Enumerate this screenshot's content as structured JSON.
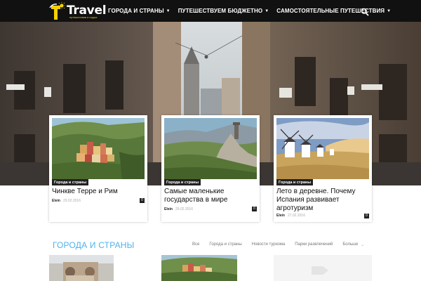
{
  "header": {
    "logo_text": "Travel",
    "logo_subtitle": "путешествия и отдых",
    "nav": [
      {
        "label": "Города и страны"
      },
      {
        "label": "Путешествуем бюджетно"
      },
      {
        "label": "Самостоятельные путешествия"
      }
    ],
    "search_icon": "search-icon"
  },
  "featured": [
    {
      "category": "Города и страны",
      "title": "Чинкве Терре и Рим",
      "author": "Elein",
      "date": "29.02.2016",
      "comments": "0"
    },
    {
      "category": "Города и страны",
      "title": "Самые маленькие государства в мире",
      "author": "Elein",
      "date": "29.02.2016",
      "comments": "0"
    },
    {
      "category": "Города и страны",
      "title": "Лето в деревне. Почему Испания развивает агротуризм",
      "author": "Elein",
      "date": "27.02.2016",
      "comments": "0"
    }
  ],
  "section": {
    "title": "Города и страны",
    "filters": [
      "Все",
      "Города и страны",
      "Новости туризма",
      "Парки развлечений",
      "Больше"
    ]
  },
  "colors": {
    "topbar": "#111111",
    "accent": "#4db2ec",
    "logo_accent": "#f5d000",
    "category_badge": "#222222"
  }
}
